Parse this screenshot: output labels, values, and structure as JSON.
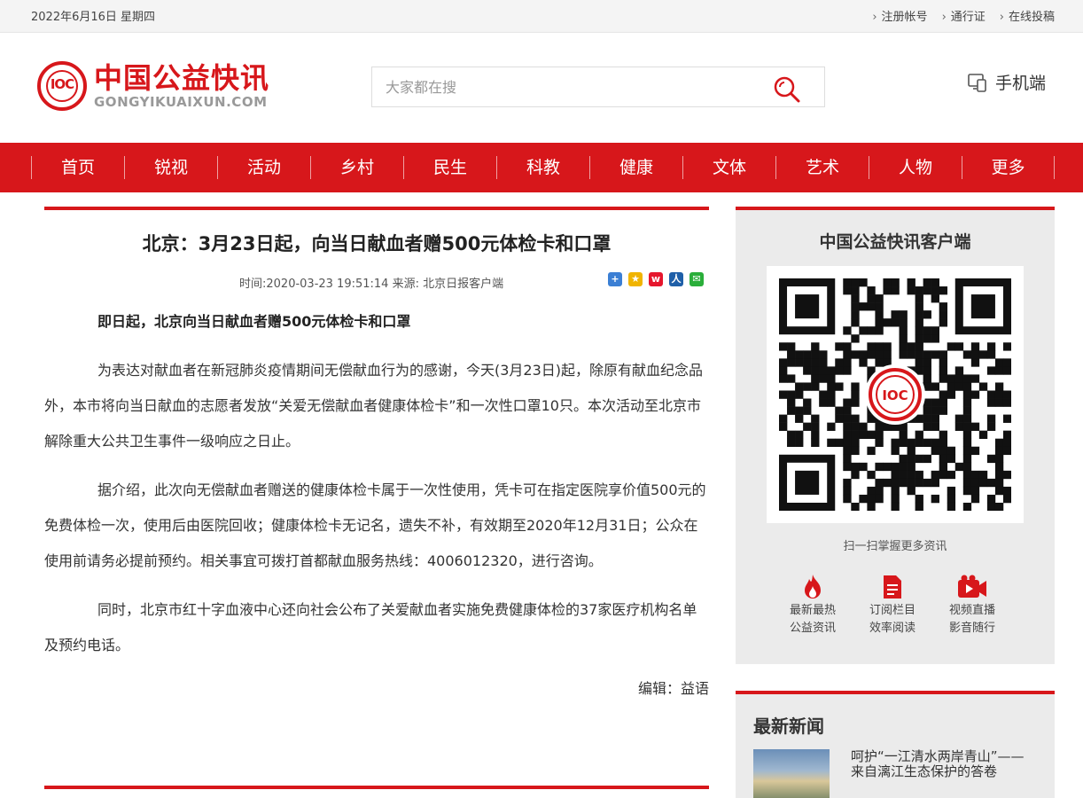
{
  "topbar": {
    "date": "2022年6月16日 星期四",
    "links": [
      "注册帐号",
      "通行证",
      "在线投稿"
    ]
  },
  "header": {
    "logo_mark": "IOC",
    "logo_cn": "中国公益快讯",
    "logo_en": "GONGYIKUAIXUN.COM",
    "search_placeholder": "大家都在搜",
    "mobile_label": "手机端"
  },
  "nav": [
    "首页",
    "锐视",
    "活动",
    "乡村",
    "民生",
    "科教",
    "健康",
    "文体",
    "艺术",
    "人物",
    "更多"
  ],
  "article": {
    "title": "北京：3月23日起，向当日献血者赠500元体检卡和口罩",
    "meta": "时间:2020-03-23 19:51:14 来源: 北京日报客户端",
    "lead": "即日起，北京向当日献血者赠500元体检卡和口罩",
    "paragraphs": [
      "为表达对献血者在新冠肺炎疫情期间无偿献血行为的感谢，今天(3月23日)起，除原有献血纪念品外，本市将向当日献血的志愿者发放“关爱无偿献血者健康体检卡”和一次性口罩10只。本次活动至北京市解除重大公共卫生事件一级响应之日止。",
      "据介绍，此次向无偿献血者赠送的健康体检卡属于一次性使用，凭卡可在指定医院享价值500元的免费体检一次，使用后由医院回收；健康体检卡无记名，遗失不补，有效期至2020年12月31日；公众在使用前请务必提前预约。相关事宜可拨打首都献血服务热线：4006012320，进行咨询。",
      "同时，北京市红十字血液中心还向社会公布了关爱献血者实施免费健康体检的37家医疗机构名单及预约电话。"
    ],
    "editor": "编辑：益语"
  },
  "sidebar": {
    "app_title": "中国公益快讯客户端",
    "scan_tip": "扫一扫掌握更多资讯",
    "features": [
      {
        "icon": "flame-icon",
        "line1": "最新最热",
        "line2": "公益资讯",
        "color": "#d7171b"
      },
      {
        "icon": "document-icon",
        "line1": "订阅栏目",
        "line2": "效率阅读",
        "color": "#d7171b"
      },
      {
        "icon": "video-icon",
        "line1": "视频直播",
        "line2": "影音随行",
        "color": "#d7171b"
      }
    ],
    "news_title": "最新新闻",
    "news": [
      {
        "title": "呵护“一江清水两岸青山”——来自漓江生态保护的答卷"
      }
    ]
  },
  "colors": {
    "brand_red": "#d7171b",
    "panel_gray": "#ebebeb"
  }
}
